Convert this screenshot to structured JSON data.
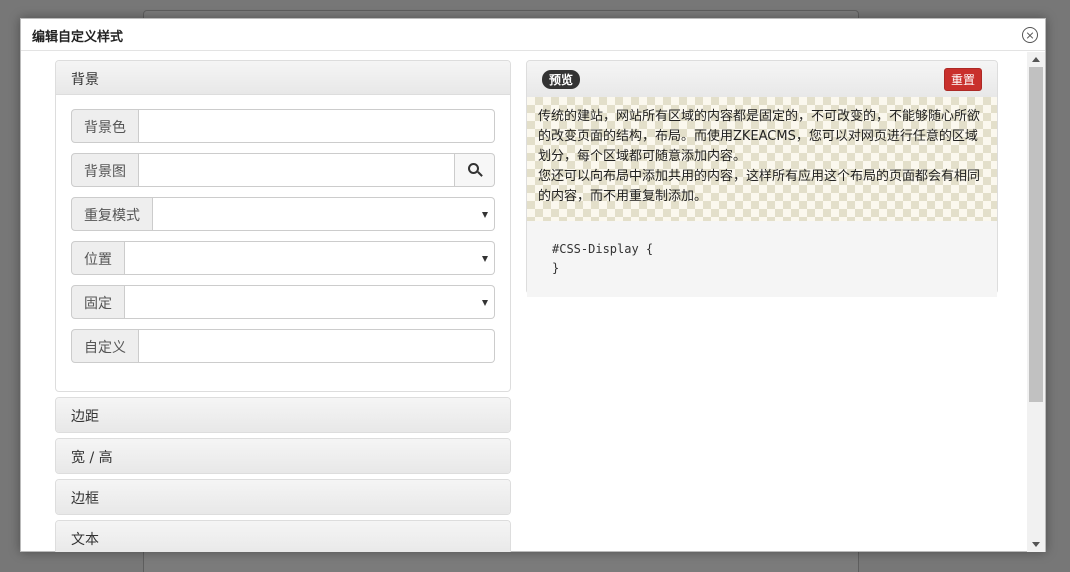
{
  "dialog": {
    "title": "编辑自定义样式"
  },
  "background_panel": {
    "heading": "背景",
    "fields": {
      "bg_color": {
        "label": "背景色",
        "value": ""
      },
      "bg_image": {
        "label": "背景图",
        "value": ""
      },
      "repeat": {
        "label": "重复模式",
        "value": ""
      },
      "position": {
        "label": "位置",
        "value": ""
      },
      "attachment": {
        "label": "固定",
        "value": ""
      },
      "custom": {
        "label": "自定义",
        "value": ""
      }
    }
  },
  "sections": {
    "margin": "边距",
    "size": "宽 / 高",
    "border": "边框",
    "text": "文本"
  },
  "preview": {
    "badge": "预览",
    "reset_label": "重置",
    "paragraph1": "传统的建站，网站所有区域的内容都是固定的，不可改变的，不能够随心所欲的改变页面的结构，布局。而使用ZKEACMS，您可以对网页进行任意的区域划分，每个区域都可随意添加内容。",
    "paragraph2": "您还可以向布局中添加共用的内容，这样所有应用这个布局的页面都会有相同的内容，而不用重复制添加。",
    "code_line1": "#CSS-Display {",
    "code_line2": "}"
  },
  "icons": {
    "close": "close-icon",
    "search": "search-icon",
    "dropdown": "caret-down-icon"
  },
  "colors": {
    "reset_button": "#c9302c",
    "badge": "#333333",
    "checker": "#e3dfca"
  }
}
